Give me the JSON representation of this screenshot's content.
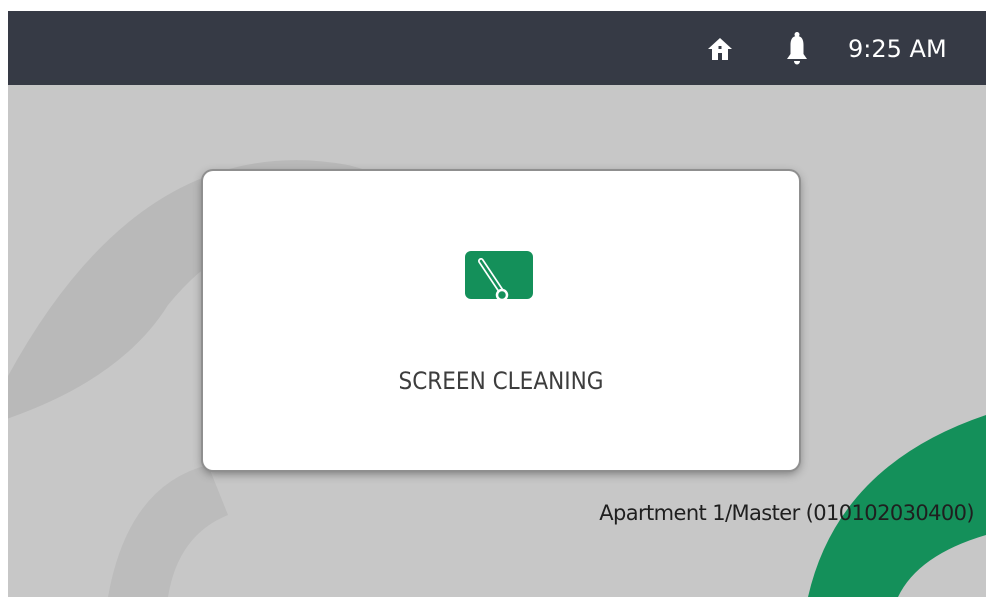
{
  "status_bar": {
    "home_icon": "home-icon",
    "notification_icon": "bell-icon",
    "time": "9:25 AM",
    "background_color": "#363a45",
    "icon_color": "#ffffff"
  },
  "main": {
    "background_color": "#c7c7c7",
    "accent_color": "#14905a",
    "card": {
      "icon": "screen-cleaning-icon",
      "label": "SCREEN CLEANING"
    },
    "device_identity": "Apartment 1/Master (010102030400)"
  }
}
